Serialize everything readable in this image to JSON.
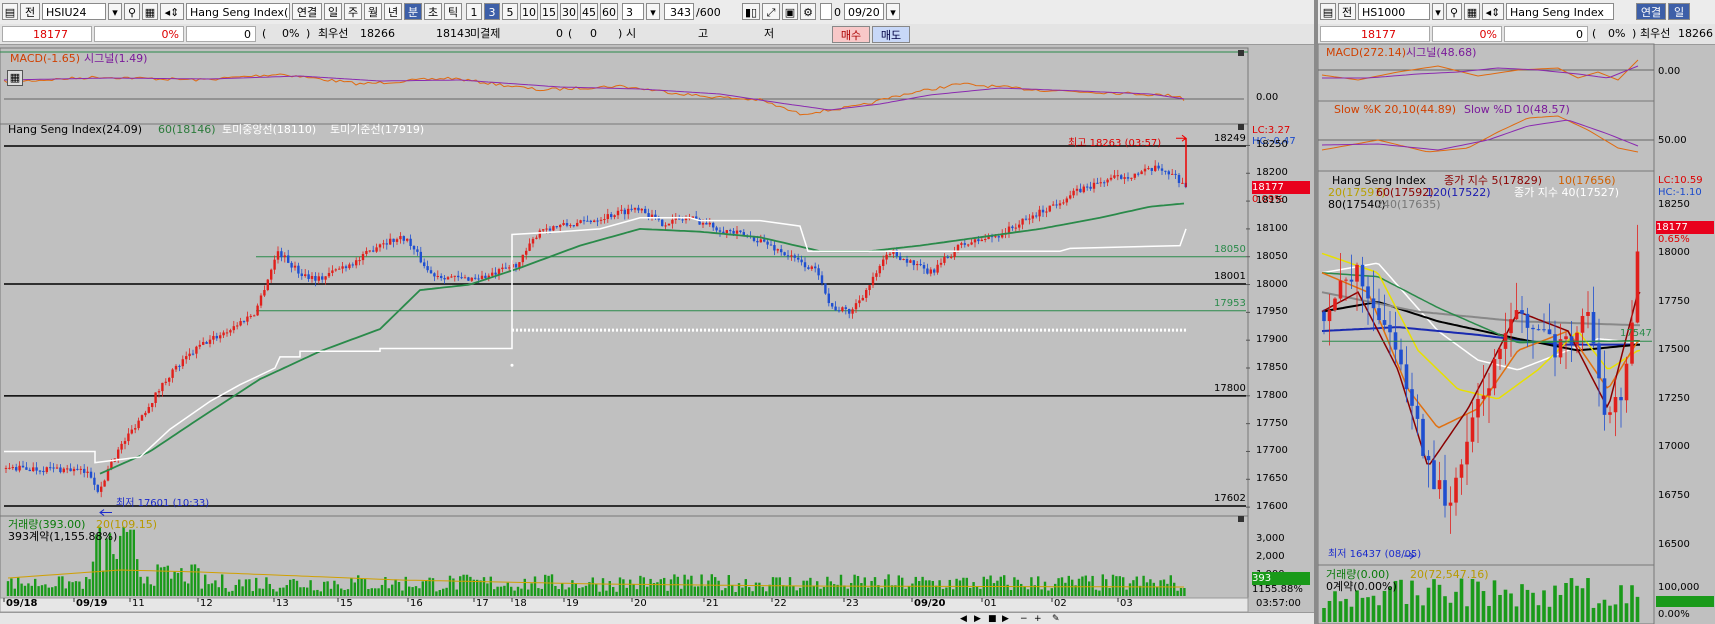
{
  "left": {
    "toolbar": {
      "code": "HSIU24",
      "name": "Hang Seng Index(24.09)",
      "tf_labels": [
        "연결",
        "일",
        "주",
        "월",
        "년",
        "분",
        "초",
        "틱"
      ],
      "tf_selected": "분",
      "intervals": [
        "1",
        "3",
        "5",
        "10",
        "15",
        "30",
        "45",
        "60"
      ],
      "interval_selected": "3",
      "period_value": "3",
      "count_value": "343",
      "count_max": "/600",
      "date_value": "09/20",
      "checkbox_label": "0"
    },
    "info": {
      "price": "18177",
      "pct": "0%",
      "change": "0",
      "change_pct": "0%",
      "best_ask_label": "최우선",
      "best_ask": "18266",
      "best_bid": "18143",
      "unsettled_label": "미결제",
      "unsettled": "0",
      "unsettled_chg": "0",
      "open_label": "시",
      "high_label": "고",
      "low_label": "저",
      "buy_label": "매수",
      "sell_label": "매도"
    },
    "macd": {
      "legend_macd": "MACD(-1.65)",
      "legend_signal": "시그널(1.49)",
      "axis": "0.00"
    },
    "price_pane": {
      "legend_name": "Hang Seng Index(24.09)",
      "legend_ma": "60(18146)",
      "legend_line1": "토미중앙선(18110)",
      "legend_line2": "토미기준선(17919)",
      "lc": "LC:3.27",
      "hc": "HC:-0.47",
      "high_text": "최고 18263 (03:57)",
      "low_text": "최저 17601 (10:33)",
      "last_price": "18177",
      "last_pct": "0.09%",
      "h_lines": [
        {
          "label": "18249",
          "value": 18249,
          "color": "#000000"
        },
        {
          "label": "18050",
          "value": 18050,
          "color": "#2a8a4a"
        },
        {
          "label": "18001",
          "value": 18001,
          "color": "#000000"
        },
        {
          "label": "17953",
          "value": 17953,
          "color": "#2a8a4a"
        },
        {
          "label": "17800",
          "value": 17800,
          "color": "#000000"
        },
        {
          "label": "17602",
          "value": 17602,
          "color": "#000000"
        }
      ],
      "y_ticks": [
        "18250",
        "18200",
        "18150",
        "18100",
        "18050",
        "18000",
        "17950",
        "17900",
        "17850",
        "17800",
        "17750",
        "17700",
        "17650",
        "17600"
      ]
    },
    "volume_pane": {
      "legend_vol": "거래량(393.00)",
      "legend_ma": "20(109.15)",
      "legend_contracts": "393계약(1,155.88%)",
      "y_ticks": [
        "3,000",
        "2,000",
        "1,000"
      ],
      "last_vol": "393",
      "last_pct": "1155.88%"
    },
    "x_axis": {
      "labels": [
        "09/18",
        "09/19",
        "11",
        "12",
        "13",
        "15",
        "16",
        "17",
        "18",
        "19",
        "20",
        "21",
        "22",
        "23",
        "09/20",
        "01",
        "02",
        "03"
      ],
      "time": "03:57:00"
    }
  },
  "right": {
    "toolbar": {
      "code": "HS1000",
      "name": "Hang Seng Index",
      "btn1": "연결",
      "btn2": "일"
    },
    "info": {
      "price": "18177",
      "pct": "0%",
      "change": "0",
      "change_pct": "0%",
      "best_ask_label": "최우선",
      "best_ask": "18266"
    },
    "macd": {
      "legend_macd": "MACD(272.14)",
      "legend_signal": "시그널(48.68)",
      "axis": "0.00"
    },
    "stoch": {
      "legend_k": "Slow %K 20,10(44.89)",
      "legend_d": "Slow %D 10(48.57)",
      "axis": "50.00"
    },
    "price_pane": {
      "legend_name": "Hang Seng Index",
      "legend_ma5": "종가 지수 5(17829)",
      "legend_ma10": "10(17656)",
      "legend_ma20": "20(17597)",
      "legend_ma60": "60(17592)",
      "legend_ma120": "120(17522)",
      "legend_ma40": "종가 지수 40(17527)",
      "legend_ma80": "80(17540)",
      "legend_ma240": "240(17635)",
      "lc": "LC:10.59",
      "hc": "HC:-1.10",
      "last_price": "18177",
      "last_pct": "0.65%",
      "ma_value": "17547",
      "low_text": "최저 16437 (08/05)",
      "y_ticks": [
        "18250",
        "18000",
        "17750",
        "17500",
        "17250",
        "17000",
        "16750",
        "16500"
      ]
    },
    "volume_pane": {
      "legend_vol": "거래량(0.00)",
      "legend_ma": "20(72,547.16)",
      "legend_contracts": "0계약(0.00%)",
      "y_ticks": [
        "100,000"
      ],
      "last_pct": "0.00%"
    }
  },
  "colors": {
    "up": "#e0201c",
    "down": "#1f4fd0",
    "ma_green": "#2a8a4a",
    "panel_bg": "#c0c0c0",
    "highlight_red": "#e8001c",
    "vol_green": "#1a9a1a",
    "buy_bg": "#f8c8c8",
    "sell_bg": "#c8d8f8"
  }
}
